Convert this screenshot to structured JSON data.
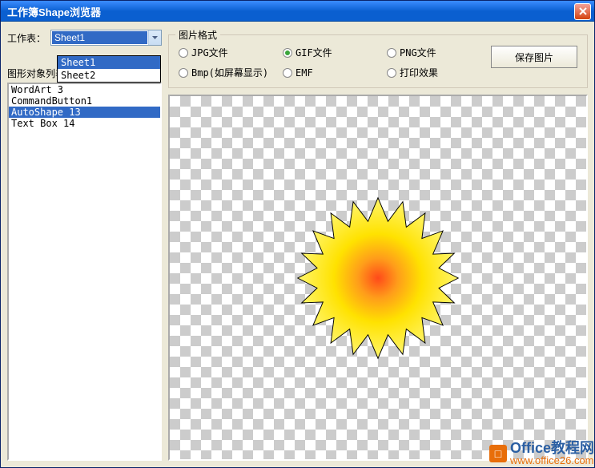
{
  "window": {
    "title": "工作簿Shape浏览器"
  },
  "worksheet": {
    "label": "工作表：",
    "selected": "Sheet1",
    "options": [
      "Sheet1",
      "Sheet2"
    ]
  },
  "shapes": {
    "label": "图形对象列表：",
    "items": [
      "WordArt 3",
      "CommandButton1",
      "AutoShape 13",
      "Text Box 14"
    ],
    "selected_index": 2
  },
  "format_group": {
    "legend": "图片格式",
    "options_row1": [
      {
        "label": "JPG文件",
        "checked": false
      },
      {
        "label": "GIF文件",
        "checked": true
      },
      {
        "label": "PNG文件",
        "checked": false
      }
    ],
    "options_row2": [
      {
        "label": "Bmp(如屏幕显示)",
        "checked": false
      },
      {
        "label": "EMF",
        "checked": false
      },
      {
        "label": "打印效果",
        "checked": false
      }
    ],
    "save_button": "保存图片"
  },
  "watermark": {
    "line1": "Office教程网",
    "line2": "www.office26.com"
  }
}
